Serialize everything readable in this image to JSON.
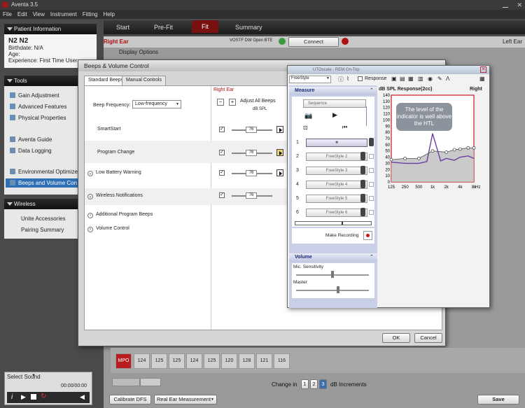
{
  "app": {
    "title": "Aventa 3.5"
  },
  "menu": [
    "File",
    "Edit",
    "View",
    "Instrument",
    "Fitting",
    "Help"
  ],
  "sidebar": {
    "patient_header": "Patient Information",
    "patient_name": "N2 N2",
    "birthdate": "Birthdate: N/A",
    "age": "Age:",
    "experience": "Experience: First Time User",
    "tools_header": "Tools",
    "tools": [
      "Gain Adjustment",
      "Advanced Features",
      "Physical Properties",
      "Aventa Guide",
      "Data Logging",
      "Environmental Optimizer",
      "Beeps and Volume Con"
    ],
    "wireless_header": "Wireless",
    "wireless": [
      "Unite Accessories",
      "Pairing Summary"
    ],
    "select_sound": "Select Sound",
    "time": "00:00/00:00"
  },
  "tabs": [
    "Start",
    "Pre-Fit",
    "Fit",
    "Summary"
  ],
  "earbar": {
    "right_ear": "Right Ear",
    "device": "VOSTF DW Open BTE",
    "connect": "Connect",
    "left_ear": "Left Ear",
    "display_options": "Display Options"
  },
  "dialog": {
    "title": "Beeps & Volume Control",
    "tabs": [
      "Standard Beeps",
      "Manual Controls"
    ],
    "right_ear": "Right Ear",
    "adjust_all": "Adjust All Beeps",
    "unit": "dB SPL",
    "beep_frequency_label": "Beep Frequency:",
    "beep_frequency_value": "Low-frequency",
    "rows": [
      "SmartStart",
      "Program Change",
      "Low Battery Warning",
      "Wireless Notifications",
      "Additional Program Beeps",
      "Volume Control"
    ],
    "values": [
      "76",
      "76",
      "76",
      "76"
    ],
    "ok": "OK",
    "cancel": "Cancel"
  },
  "popup": {
    "title": "UTOscale - REM On-Top",
    "program": "FreeStyle",
    "response": "Response",
    "measure": "Measure",
    "sequence": "Sequence",
    "items": [
      "FreeStyle 2",
      "FreeStyle 3",
      "FreeStyle 4",
      "FreeStyle 5",
      "FreeStyle 6"
    ],
    "item_nums": [
      "1",
      "2",
      "3",
      "4",
      "5",
      "6"
    ],
    "make_recording": "Make Recording",
    "volume": "Volume",
    "mic_sensitivity": "Mic. Sensitivity",
    "master": "Master",
    "chart_title": "dB SPL Response(2cc)",
    "chart_side": "Right",
    "callout": "The level of the indicator is well above the HTL"
  },
  "chart_data": {
    "type": "line",
    "title": "dB SPL Response(2cc)",
    "xlabel": "Hz",
    "ylabel": "",
    "x_ticks": [
      "125",
      "250",
      "500",
      "1k",
      "2k",
      "4k",
      "8k"
    ],
    "y_ticks": [
      140,
      130,
      120,
      110,
      100,
      90,
      80,
      70,
      60,
      50,
      40,
      30,
      20,
      10,
      0
    ],
    "ylim": [
      0,
      140
    ],
    "series": [
      {
        "x": [
          125,
          250,
          500,
          750,
          1000,
          1500,
          2000,
          3000,
          4000,
          6000,
          8000
        ],
        "values": [
          32,
          30,
          30,
          33,
          78,
          34,
          38,
          35,
          40,
          42,
          38
        ]
      },
      {
        "x": [
          125,
          250,
          500,
          1000,
          2000,
          3000,
          4000,
          6000,
          8000
        ],
        "values": [
          36,
          38,
          38,
          50,
          48,
          52,
          53,
          55,
          55
        ]
      }
    ]
  },
  "bottom": {
    "mpo": "MPO",
    "cells": [
      "124",
      "125",
      "125",
      "124",
      "125",
      "120",
      "128",
      "121",
      "116"
    ],
    "change_in": "Change in",
    "steps": [
      "1",
      "2",
      "3"
    ],
    "increments": "dB Increments",
    "calibrate": "Calibrate DFS",
    "rem": "Real Ear Measurement",
    "save": "Save"
  },
  "colors": {
    "accent": "#7a1111",
    "selection": "#2f6fb5",
    "highlight": "#c41a1a"
  }
}
